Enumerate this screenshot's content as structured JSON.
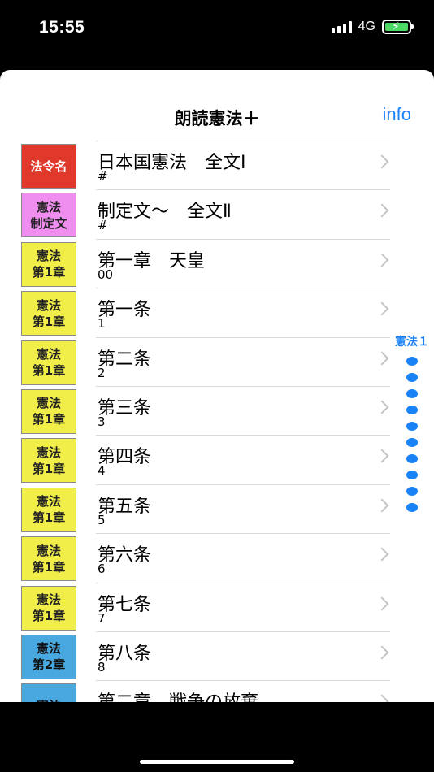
{
  "status": {
    "time": "15:55",
    "network": "4G"
  },
  "nav": {
    "title": "朗読憲法＋",
    "info": "info"
  },
  "rows": [
    {
      "badge": [
        "法令名"
      ],
      "color": "red",
      "title": "日本国憲法　全文Ⅰ",
      "sub": "#"
    },
    {
      "badge": [
        "憲法",
        "制定文"
      ],
      "color": "pink",
      "title": "制定文〜　全文Ⅱ",
      "sub": "#"
    },
    {
      "badge": [
        "憲法",
        "第1章"
      ],
      "color": "yellow",
      "title": "第一章　天皇",
      "sub": "00"
    },
    {
      "badge": [
        "憲法",
        "第1章"
      ],
      "color": "yellow",
      "title": "第一条",
      "sub": "1"
    },
    {
      "badge": [
        "憲法",
        "第1章"
      ],
      "color": "yellow",
      "title": "第二条",
      "sub": "2"
    },
    {
      "badge": [
        "憲法",
        "第1章"
      ],
      "color": "yellow",
      "title": "第三条",
      "sub": "3"
    },
    {
      "badge": [
        "憲法",
        "第1章"
      ],
      "color": "yellow",
      "title": "第四条",
      "sub": "4"
    },
    {
      "badge": [
        "憲法",
        "第1章"
      ],
      "color": "yellow",
      "title": "第五条",
      "sub": "5"
    },
    {
      "badge": [
        "憲法",
        "第1章"
      ],
      "color": "yellow",
      "title": "第六条",
      "sub": "6"
    },
    {
      "badge": [
        "憲法",
        "第1章"
      ],
      "color": "yellow",
      "title": "第七条",
      "sub": "7"
    },
    {
      "badge": [
        "憲法",
        "第2章"
      ],
      "color": "blue",
      "title": "第八条",
      "sub": "8"
    },
    {
      "badge": [
        "憲法"
      ],
      "color": "blue",
      "title": "第二章　戦争の放棄",
      "sub": ""
    }
  ],
  "index": {
    "label": "憲法１",
    "dots": 10
  }
}
